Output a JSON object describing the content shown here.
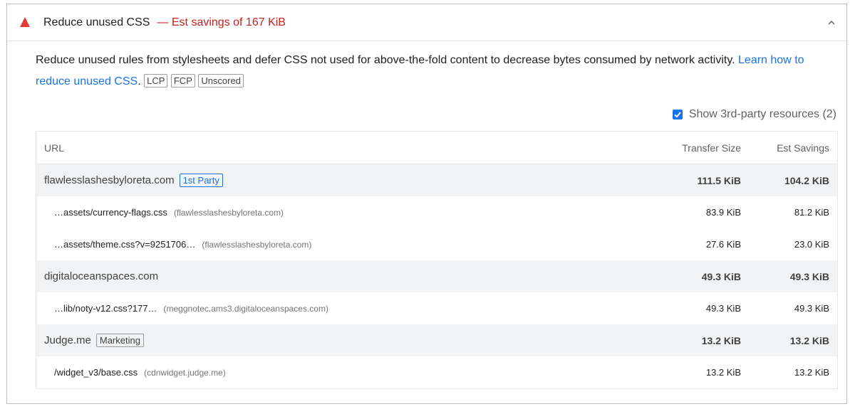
{
  "audit": {
    "title": "Reduce unused CSS",
    "savings": "— Est savings of 167 KiB",
    "description": "Reduce unused rules from stylesheets and defer CSS not used for above-the-fold content to decrease bytes consumed by network activity.",
    "learn_more": "Learn how to reduce unused CSS",
    "tags": [
      "LCP",
      "FCP",
      "Unscored"
    ]
  },
  "third_party": {
    "label": "Show 3rd-party resources (2)",
    "checked": true
  },
  "table": {
    "headers": {
      "url": "URL",
      "transfer_size": "Transfer Size",
      "est_savings": "Est Savings"
    },
    "groups": [
      {
        "name": "flawlesslashesbyloreta.com",
        "badge": "1st Party",
        "transfer_size": "111.5 KiB",
        "est_savings": "104.2 KiB",
        "items": [
          {
            "url": "…assets/currency-flags.css",
            "host": "(flawlesslashesbyloreta.com)",
            "transfer_size": "83.9 KiB",
            "est_savings": "81.2 KiB"
          },
          {
            "url": "…assets/theme.css?v=9251706…",
            "host": "(flawlesslashesbyloreta.com)",
            "transfer_size": "27.6 KiB",
            "est_savings": "23.0 KiB"
          }
        ]
      },
      {
        "name": "digitaloceanspaces.com",
        "badge": "",
        "transfer_size": "49.3 KiB",
        "est_savings": "49.3 KiB",
        "items": [
          {
            "url": "…lib/noty-v12.css?177…",
            "host": "(meggnotec.ams3.digitaloceanspaces.com)",
            "transfer_size": "49.3 KiB",
            "est_savings": "49.3 KiB"
          }
        ]
      },
      {
        "name": "Judge.me",
        "badge": "Marketing",
        "transfer_size": "13.2 KiB",
        "est_savings": "13.2 KiB",
        "items": [
          {
            "url": "/widget_v3/base.css",
            "host": "(cdnwidget.judge.me)",
            "transfer_size": "13.2 KiB",
            "est_savings": "13.2 KiB"
          }
        ]
      }
    ]
  },
  "colors": {
    "warning": "#e53935",
    "savings": "#c5221f",
    "link": "#1a73e8",
    "group_bg": "#f1f3f4"
  },
  "icons": {
    "status": "warning-triangle-icon",
    "toggle": "chevron-up-icon",
    "checkbox": "checkmark-icon"
  }
}
